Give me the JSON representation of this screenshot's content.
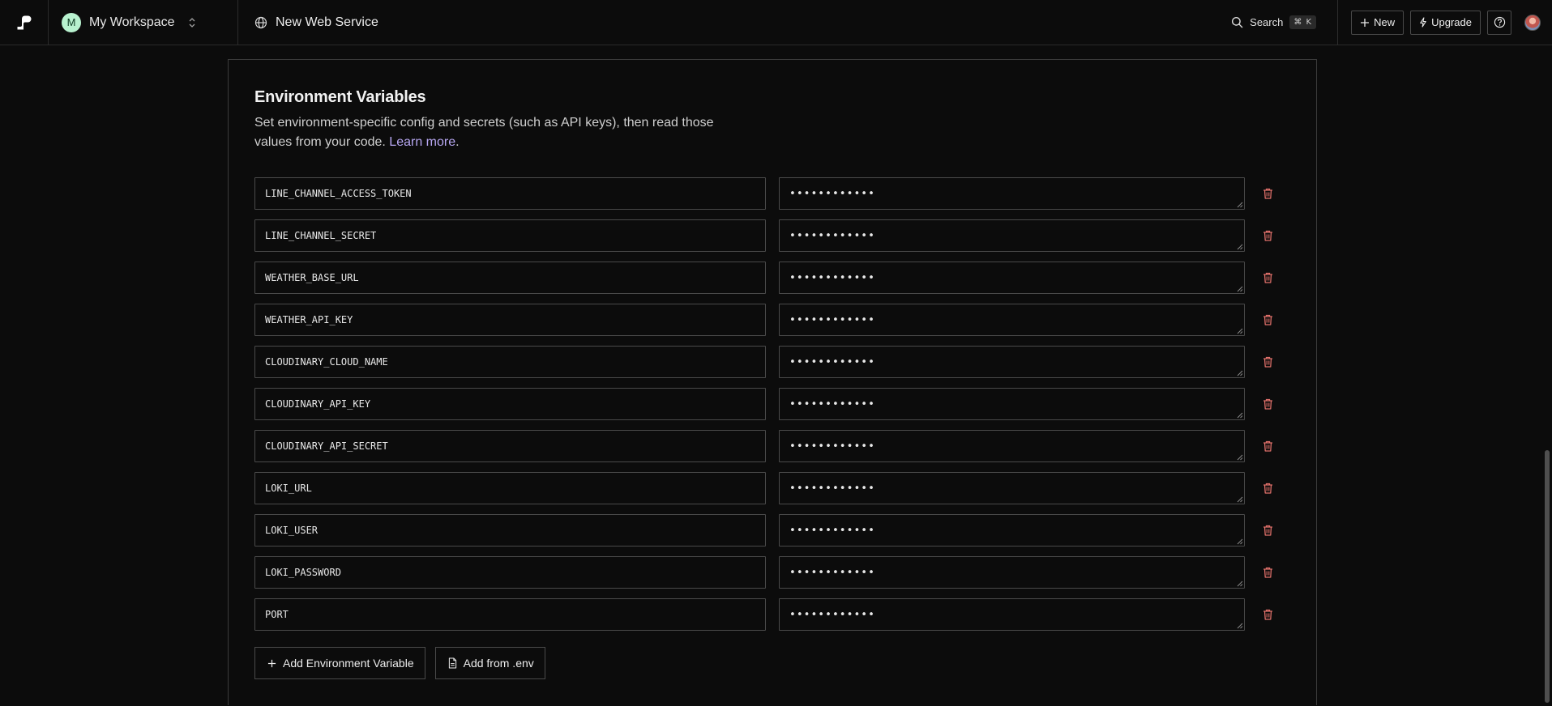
{
  "workspace": {
    "initial": "M",
    "name": "My Workspace"
  },
  "page": {
    "title": "New Web Service"
  },
  "search": {
    "label": "Search",
    "shortcut": "⌘ K"
  },
  "topbar_actions": {
    "new_label": "New",
    "upgrade_label": "Upgrade"
  },
  "section": {
    "title": "Environment Variables",
    "description": "Set environment-specific config and secrets (such as API keys), then read those values from your code. ",
    "learn_more": "Learn more",
    "learn_more_suffix": "."
  },
  "env_vars": [
    {
      "key": "LINE_CHANNEL_ACCESS_TOKEN",
      "value": "••••••••••••"
    },
    {
      "key": "LINE_CHANNEL_SECRET",
      "value": "••••••••••••"
    },
    {
      "key": "WEATHER_BASE_URL",
      "value": "••••••••••••"
    },
    {
      "key": "WEATHER_API_KEY",
      "value": "••••••••••••"
    },
    {
      "key": "CLOUDINARY_CLOUD_NAME",
      "value": "••••••••••••"
    },
    {
      "key": "CLOUDINARY_API_KEY",
      "value": "••••••••••••"
    },
    {
      "key": "CLOUDINARY_API_SECRET",
      "value": "••••••••••••"
    },
    {
      "key": "LOKI_URL",
      "value": "••••••••••••"
    },
    {
      "key": "LOKI_USER",
      "value": "••••••••••••"
    },
    {
      "key": "LOKI_PASSWORD",
      "value": "••••••••••••"
    },
    {
      "key": "PORT",
      "value": "••••••••••••"
    }
  ],
  "buttons": {
    "add_env_var": "Add Environment Variable",
    "add_from_env": "Add from .env"
  },
  "colors": {
    "background": "#0c0c0c",
    "border": "#4a4a4a",
    "link": "#b7a7f2",
    "delete": "#e0706a",
    "workspace_avatar": "#b8f2cf"
  },
  "icons": {
    "logo": "render-logo-icon",
    "workspace_switch": "chevron-up-down-icon",
    "page": "globe-icon",
    "search": "search-icon",
    "new": "plus-icon",
    "upgrade": "lightning-icon",
    "help": "help-circle-icon",
    "delete": "trash-icon",
    "add": "plus-icon",
    "file": "file-icon"
  }
}
